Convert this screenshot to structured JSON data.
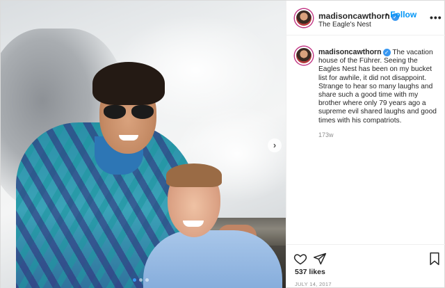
{
  "post": {
    "photo_alt": "",
    "carousel": {
      "count": 3,
      "active_index": 0
    }
  },
  "header": {
    "username": "madisoncawthorn",
    "verified_glyph": "✓",
    "separator": "•",
    "follow_label": "Follow",
    "location": "The Eagle's Nest",
    "more_glyph": "•••"
  },
  "caption": {
    "username": "madisoncawthorn",
    "text": "The vacation house of the Führer. Seeing the Eagles Nest has been on my bucket list for awhile, it did not disappoint. Strange to hear so many laughs and share such a good time with my brother where only 79 years ago a supreme evil shared laughs and good times with his compatriots.",
    "age": "173w"
  },
  "actions": {
    "likes": "537 likes",
    "date": "JULY 14, 2017",
    "icons": [
      "heart-icon",
      "send-icon",
      "bookmark-icon"
    ]
  },
  "colors": {
    "link_blue": "#0095f6",
    "verified_blue": "#3897f0",
    "muted_text": "#8e8e8e",
    "border": "#efefef"
  }
}
